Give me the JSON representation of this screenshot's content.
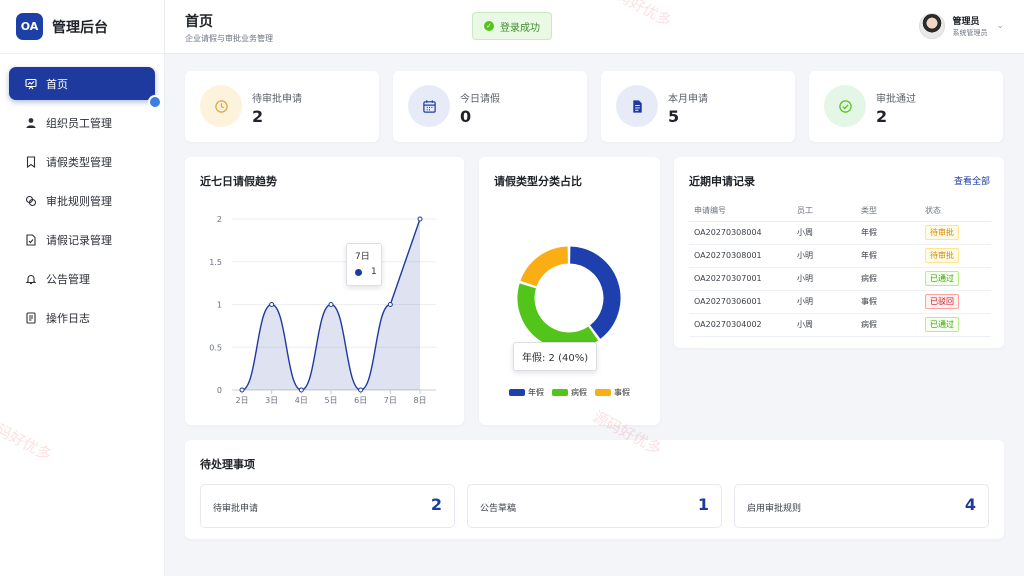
{
  "brand": {
    "logo": "OA",
    "title": "管理后台"
  },
  "nav": [
    {
      "label": "首页",
      "icon": "dashboard-icon",
      "active": true
    },
    {
      "label": "组织员工管理",
      "icon": "user-icon"
    },
    {
      "label": "请假类型管理",
      "icon": "bookmark-icon"
    },
    {
      "label": "审批规则管理",
      "icon": "rules-icon"
    },
    {
      "label": "请假记录管理",
      "icon": "document-check-icon"
    },
    {
      "label": "公告管理",
      "icon": "bell-icon"
    },
    {
      "label": "操作日志",
      "icon": "log-icon"
    }
  ],
  "header": {
    "title": "首页",
    "subtitle": "企业请假与审批业务管理"
  },
  "toast": {
    "text": "登录成功",
    "color": "#52c41a"
  },
  "user": {
    "name": "管理员",
    "role": "系统管理员"
  },
  "stats": [
    {
      "label": "待审批申请",
      "value": "2",
      "icon": "clock-icon",
      "bg": "#fdf3dc",
      "color": "#e6a23c"
    },
    {
      "label": "今日请假",
      "value": "0",
      "icon": "calendar-icon",
      "bg": "#e7ebf7",
      "color": "#1e3a9e"
    },
    {
      "label": "本月申请",
      "value": "5",
      "icon": "document-icon",
      "bg": "#e7ebf7",
      "color": "#1e3a9e"
    },
    {
      "label": "审批通过",
      "value": "2",
      "icon": "check-circle-icon",
      "bg": "#e4f6e6",
      "color": "#52c41a"
    }
  ],
  "trend": {
    "title": "近七日请假趋势",
    "tooltip": {
      "label": "7日",
      "value": "1"
    }
  },
  "pie": {
    "title": "请假类型分类占比",
    "tooltip": "年假: 2 (40%)"
  },
  "records": {
    "title": "近期申请记录",
    "view_all": "查看全部",
    "columns": [
      "申请编号",
      "员工",
      "类型",
      "状态"
    ],
    "rows": [
      {
        "id": "OA20270308004",
        "employee": "小周",
        "type": "年假",
        "status": "待审批",
        "status_kind": "pending"
      },
      {
        "id": "OA20270308001",
        "employee": "小明",
        "type": "年假",
        "status": "待审批",
        "status_kind": "pending"
      },
      {
        "id": "OA20270307001",
        "employee": "小明",
        "type": "病假",
        "status": "已通过",
        "status_kind": "approved"
      },
      {
        "id": "OA20270306001",
        "employee": "小明",
        "type": "事假",
        "status": "已驳回",
        "status_kind": "rejected"
      },
      {
        "id": "OA20270304002",
        "employee": "小周",
        "type": "病假",
        "status": "已通过",
        "status_kind": "approved"
      }
    ]
  },
  "pending": {
    "title": "待处理事项",
    "items": [
      {
        "label": "待审批申请",
        "count": "2"
      },
      {
        "label": "公告草稿",
        "count": "1"
      },
      {
        "label": "启用审批规则",
        "count": "4"
      }
    ]
  },
  "watermark": "源码好优多",
  "colors": {
    "primary": "#1e3a9e",
    "success": "#52c41a",
    "warning": "#faad14",
    "danger": "#f5222d"
  },
  "chart_data": [
    {
      "type": "area",
      "title": "近七日请假趋势",
      "categories": [
        "2日",
        "3日",
        "4日",
        "5日",
        "6日",
        "7日",
        "8日"
      ],
      "values": [
        0,
        1,
        0,
        1,
        0,
        1,
        2
      ],
      "ylim": [
        0,
        2
      ],
      "yticks": [
        "0",
        "0.5",
        "1",
        "1.5",
        "2"
      ],
      "grid": true,
      "color": "#1e3a9e"
    },
    {
      "type": "pie",
      "title": "请假类型分类占比",
      "labels": [
        "年假",
        "病假",
        "事假"
      ],
      "values": [
        2,
        2,
        1
      ],
      "colors": [
        "#1e3fae",
        "#52c41a",
        "#faad14"
      ],
      "legend": "bottom"
    }
  ]
}
